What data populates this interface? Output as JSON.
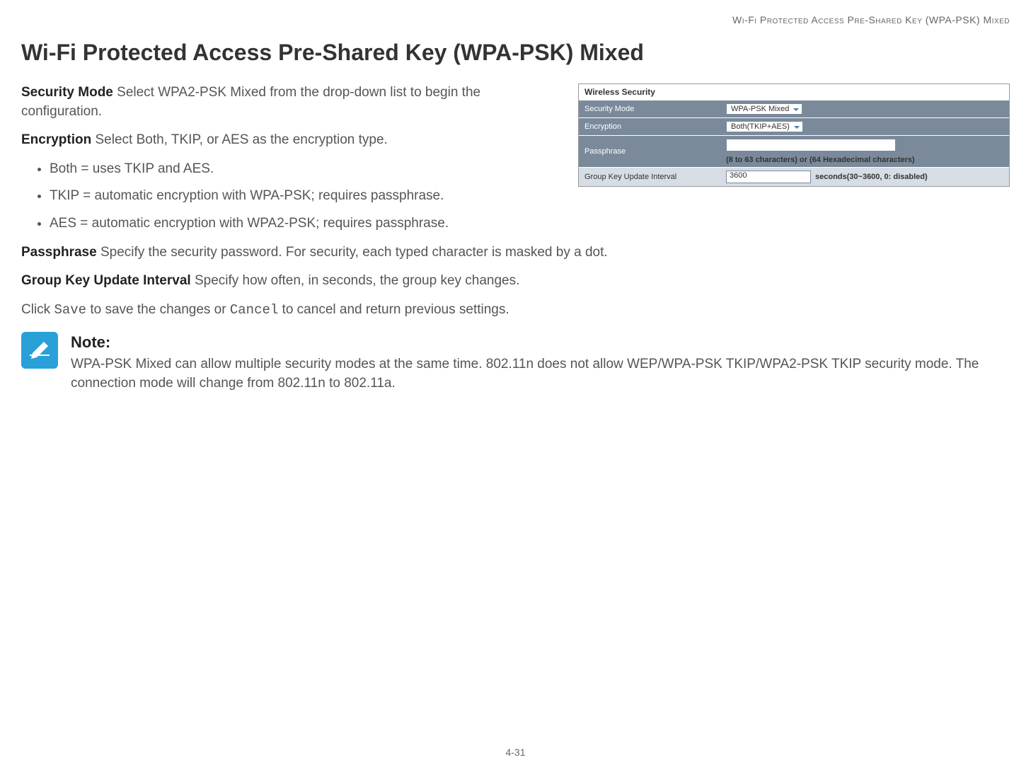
{
  "running_header": "Wi-Fi Protected Access Pre-Shared Key (WPA-PSK) Mixed",
  "heading": "Wi-Fi Protected Access Pre-Shared Key (WPA-PSK) Mixed",
  "figure": {
    "title": "Wireless Security",
    "rows": {
      "security_mode": {
        "label": "Security Mode",
        "value": "WPA-PSK Mixed"
      },
      "encryption": {
        "label": "Encryption",
        "value": "Both(TKIP+AES)"
      },
      "passphrase": {
        "label": "Passphrase",
        "value": "",
        "hint": "(8 to 63 characters) or (64 Hexadecimal characters)"
      },
      "group_key": {
        "label": "Group Key Update Interval",
        "value": "3600",
        "suffix": "seconds(30~3600, 0: disabled)"
      }
    }
  },
  "paras": {
    "security_mode_label": "Security Mode",
    "security_mode_desc": "  Select WPA2-PSK Mixed from the drop-down list to begin the configuration.",
    "encryption_label": "Encryption",
    "encryption_desc": "  Select Both, TKIP, or AES as the encryption type.",
    "passphrase_label": "Passphrase",
    "passphrase_desc": "  Specify the security password. For security, each typed character is masked by a dot.",
    "group_key_label": "Group Key Update Interval",
    "group_key_desc": "  Specify how often, in seconds, the group key changes.",
    "save_prefix": "Click ",
    "save_code": "Save",
    "save_mid": " to save the changes or ",
    "cancel_code": "Cancel",
    "save_suffix": " to cancel and return previous settings."
  },
  "bullets": {
    "both": "Both = uses TKIP and AES.",
    "tkip": "TKIP = automatic encryption with WPA-PSK; requires passphrase.",
    "aes": "AES = automatic encryption with WPA2-PSK; requires passphrase."
  },
  "note": {
    "title": "Note:",
    "body": "WPA-PSK Mixed can allow multiple security modes at the same time.  802.11n does not allow WEP/WPA-PSK TKIP/WPA2-PSK TKIP security mode. The connection mode will change from 802.11n to 802.11a."
  },
  "page_number": "4-31"
}
